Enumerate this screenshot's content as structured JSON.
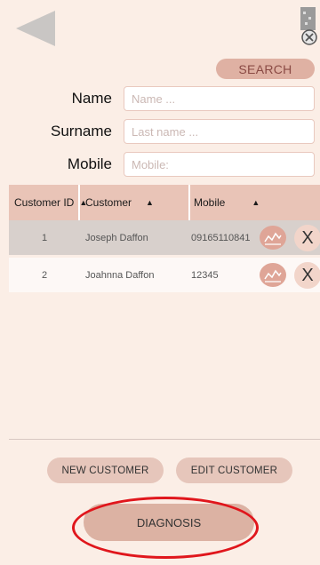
{
  "header": {
    "back_icon": "back-arrow-icon",
    "close_icon": "close-icon"
  },
  "search": {
    "button_label": "SEARCH",
    "fields": {
      "name": {
        "label": "Name",
        "placeholder": "Name ...",
        "value": ""
      },
      "surname": {
        "label": "Surname",
        "placeholder": "Last name ...",
        "value": ""
      },
      "mobile": {
        "label": "Mobile",
        "placeholder": "Mobile:",
        "value": ""
      }
    }
  },
  "table": {
    "columns": [
      {
        "label": "Customer ID",
        "sort": "▲"
      },
      {
        "label": "Customer",
        "sort": "▲"
      },
      {
        "label": "Mobile",
        "sort": "▲"
      }
    ],
    "rows": [
      {
        "id": "1",
        "customer": "Joseph Daffon",
        "mobile": "09165110841",
        "selected": true
      },
      {
        "id": "2",
        "customer": "Joahnna Daffon",
        "mobile": "12345",
        "selected": false
      }
    ],
    "row_actions": {
      "chart_icon": "chart-icon",
      "delete_label": "X"
    }
  },
  "actions": {
    "new_customer": "NEW CUSTOMER",
    "edit_customer": "EDIT CUSTOMER",
    "diagnosis": "DIAGNOSIS"
  },
  "colors": {
    "background": "#fbeee6",
    "header": "#e9c4b7",
    "accent": "#dfb1a3",
    "highlight_ring": "#e0161c"
  }
}
